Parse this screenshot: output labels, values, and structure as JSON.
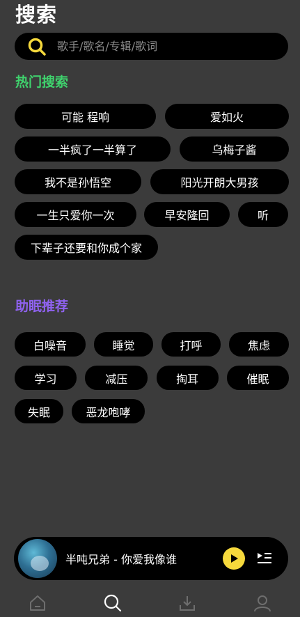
{
  "header": {
    "title": "搜索"
  },
  "search": {
    "placeholder": "歌手/歌名/专辑/歌词"
  },
  "hot": {
    "title": "热门搜索",
    "rows": [
      [
        "可能  程响",
        "爱如火"
      ],
      [
        "一半疯了一半算了",
        "乌梅子酱"
      ],
      [
        "我不是孙悟空",
        "阳光开朗大男孩"
      ],
      [
        "一生只爱你一次",
        "早安隆回",
        "听"
      ],
      [
        "下辈子还要和你成个家"
      ]
    ]
  },
  "sleep": {
    "title": "助眠推荐",
    "rows": [
      [
        "白噪音",
        "睡觉",
        "打呼",
        "焦虑"
      ],
      [
        "学习",
        "减压",
        "掏耳",
        "催眠"
      ],
      [
        "失眠",
        "恶龙咆哮"
      ]
    ]
  },
  "player": {
    "song": "半吨兄弟 - 你爱我像谁"
  },
  "nav": {
    "items": [
      "home-icon",
      "search-icon",
      "download-icon",
      "user-icon"
    ]
  },
  "colors": {
    "hot_title": "#3fd26d",
    "sleep_title": "#8f62f0",
    "accent": "#f6d93c",
    "background": "#3b3b3b"
  }
}
